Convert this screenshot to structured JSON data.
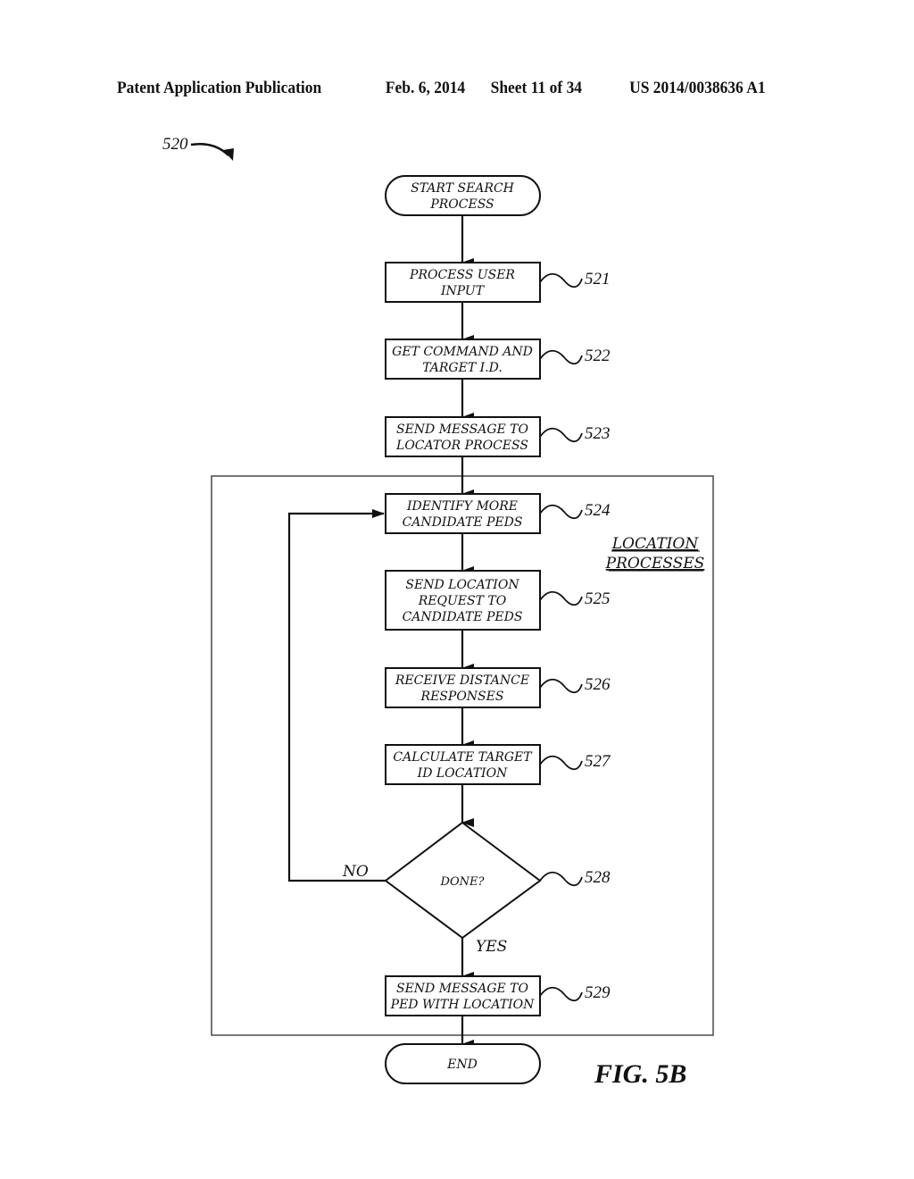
{
  "header": {
    "publication": "Patent Application Publication",
    "date": "Feb. 6, 2014",
    "sheet": "Sheet 11 of 34",
    "number": "US 2014/0038636 A1"
  },
  "figure": {
    "ref": "520",
    "title": "FIG. 5B",
    "group_label": [
      "LOCATION",
      "PROCESSES"
    ]
  },
  "nodes": {
    "start": {
      "lines": [
        "START SEARCH",
        "PROCESS"
      ]
    },
    "n521": {
      "ref": "521",
      "lines": [
        "PROCESS USER",
        "INPUT"
      ]
    },
    "n522": {
      "ref": "522",
      "lines": [
        "GET COMMAND AND",
        "TARGET I.D."
      ]
    },
    "n523": {
      "ref": "523",
      "lines": [
        "SEND MESSAGE TO",
        "LOCATOR PROCESS"
      ]
    },
    "n524": {
      "ref": "524",
      "lines": [
        "IDENTIFY MORE",
        "CANDIDATE PEDS"
      ]
    },
    "n525": {
      "ref": "525",
      "lines": [
        "SEND LOCATION",
        "REQUEST TO",
        "CANDIDATE PEDS"
      ]
    },
    "n526": {
      "ref": "526",
      "lines": [
        "RECEIVE DISTANCE",
        "RESPONSES"
      ]
    },
    "n527": {
      "ref": "527",
      "lines": [
        "CALCULATE TARGET",
        "ID LOCATION"
      ]
    },
    "n528": {
      "ref": "528",
      "lines": [
        "DONE?"
      ]
    },
    "n529": {
      "ref": "529",
      "lines": [
        "SEND MESSAGE TO",
        "PED WITH LOCATION"
      ]
    },
    "end": {
      "lines": [
        "END"
      ]
    }
  },
  "edges": {
    "no_label": "NO",
    "yes_label": "YES"
  }
}
